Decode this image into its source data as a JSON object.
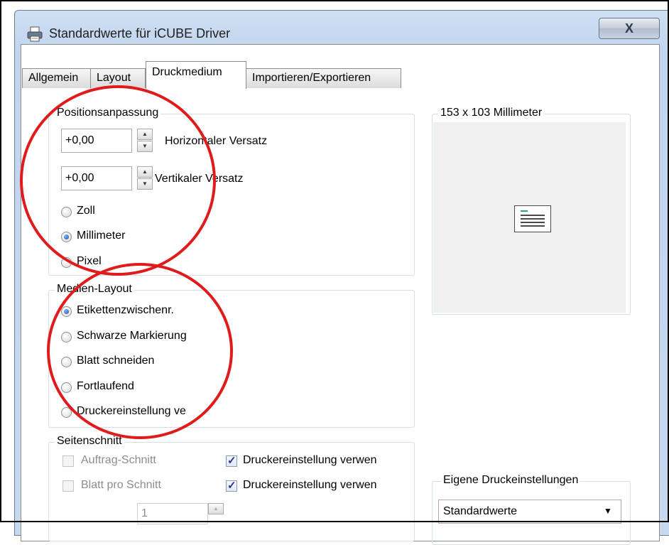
{
  "window": {
    "title": "Standardwerte für iCUBE Driver",
    "close_glyph": "X"
  },
  "tabs": [
    {
      "label": "Allgemein"
    },
    {
      "label": "Layout"
    },
    {
      "label": "Druckmedium"
    },
    {
      "label": "Importieren/Exportieren"
    }
  ],
  "position": {
    "legend": "Positionsanpassung",
    "horizontal_value": "+0,00",
    "horizontal_label": "Horizontaler Versatz",
    "vertical_value": "+0,00",
    "vertical_label": "Vertikaler Versatz",
    "units": [
      {
        "label": "Zoll",
        "checked": false
      },
      {
        "label": "Millimeter",
        "checked": true
      },
      {
        "label": "Pixel",
        "checked": false
      }
    ]
  },
  "media_layout": {
    "legend": "Medien-Layout",
    "options": [
      {
        "label": "Etikettenzwischenr.",
        "checked": true
      },
      {
        "label": "Schwarze Markierung",
        "checked": false
      },
      {
        "label": "Blatt schneiden",
        "checked": false
      },
      {
        "label": "Fortlaufend",
        "checked": false
      },
      {
        "label": "Druckereinstellung ve",
        "checked": false
      }
    ]
  },
  "page_cut": {
    "legend": "Seitenschnitt",
    "job_cut": "Auftrag-Schnitt",
    "sheets_per_cut": "Blatt pro Schnitt",
    "printer_setting_1": "Druckereinstellung verwen",
    "printer_setting_2": "Druckereinstellung verwen",
    "count_value": "1"
  },
  "preview": {
    "legend": "153 x 103 Millimeter"
  },
  "custom_settings": {
    "legend": "Eigene Druckeinstellungen",
    "selected": "Standardwerte"
  },
  "colors": {
    "annotation": "#e01b1b",
    "title_bar": "#c7d9ef"
  }
}
